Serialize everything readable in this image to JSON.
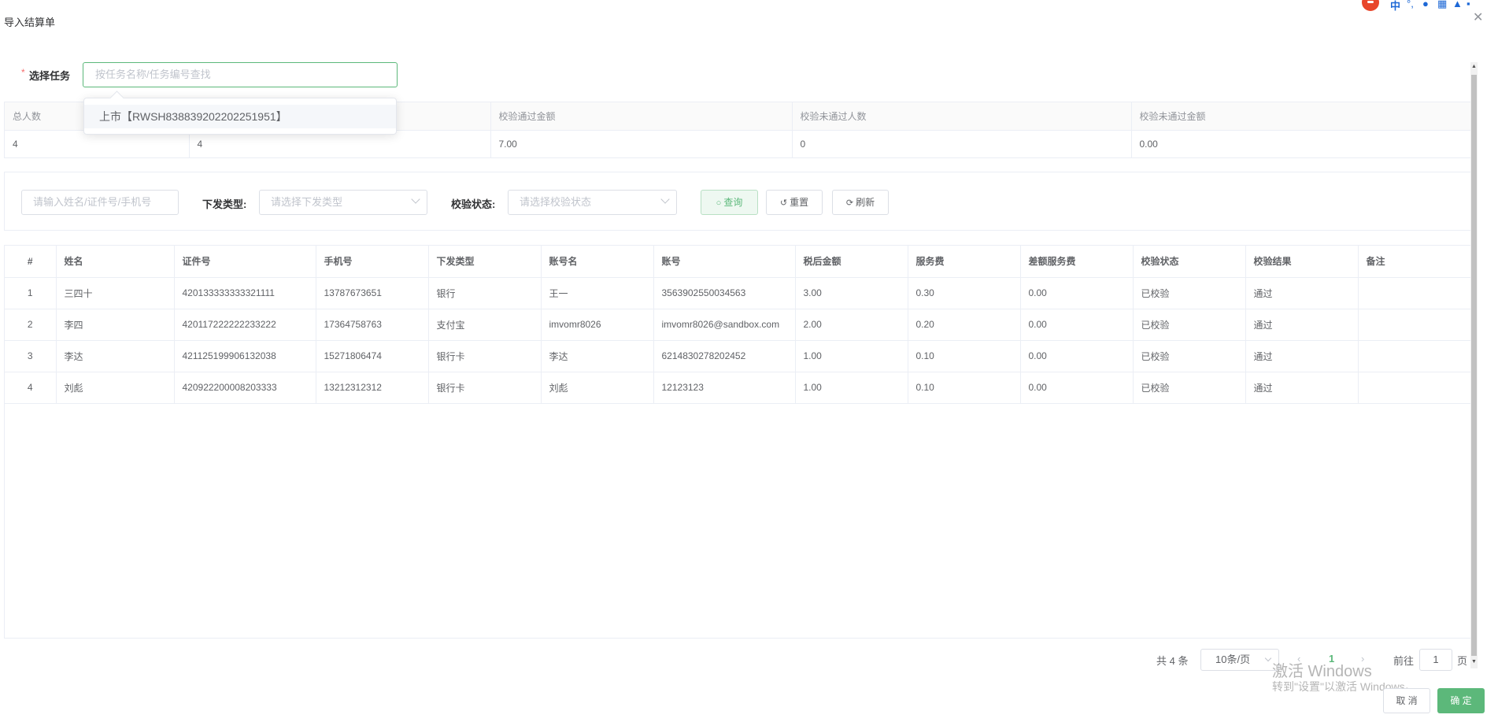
{
  "dialog": {
    "title": "导入结算单",
    "close_glyph": "✕"
  },
  "ime_toolbar": {
    "icons": [
      "sogou-logo-icon",
      "chinese-mode-icon",
      "punctuation-icon",
      "microphone-icon",
      "keyboard-icon",
      "skin-icon",
      "toolbox-icon"
    ],
    "mode_label": "中"
  },
  "form": {
    "label": "选择任务",
    "required_mark": "*",
    "task_placeholder": "按任务名称/任务编号查找",
    "dropdown_option": "上市【RWSH838839202202251951】"
  },
  "summary": {
    "headers": [
      "总人数",
      "",
      "校验通过金额",
      "校验未通过人数",
      "校验未通过金额"
    ],
    "values": [
      "4",
      "4",
      "7.00",
      "0",
      "0.00"
    ]
  },
  "filters": {
    "search_placeholder": "请输入姓名/证件号/手机号",
    "type_label": "下发类型:",
    "type_placeholder": "请选择下发类型",
    "status_label": "校验状态:",
    "status_placeholder": "请选择校验状态",
    "query_button": "查询",
    "reset_button": "重置",
    "refresh_button": "刷新"
  },
  "table": {
    "columns": [
      "#",
      "姓名",
      "证件号",
      "手机号",
      "下发类型",
      "账号名",
      "账号",
      "税后金额",
      "服务费",
      "差额服务费",
      "校验状态",
      "校验结果",
      "备注"
    ],
    "rows": [
      [
        "1",
        "三四十",
        "420133333333321111",
        "13787673651",
        "银行",
        "王一",
        "3563902550034563",
        "3.00",
        "0.30",
        "0.00",
        "已校验",
        "通过",
        ""
      ],
      [
        "2",
        "李四",
        "420117222222233222",
        "17364758763",
        "支付宝",
        "imvomr8026",
        "imvomr8026@sandbox.com",
        "2.00",
        "0.20",
        "0.00",
        "已校验",
        "通过",
        ""
      ],
      [
        "3",
        "李达",
        "421125199906132038",
        "15271806474",
        "银行卡",
        "李达",
        "6214830278202452",
        "1.00",
        "0.10",
        "0.00",
        "已校验",
        "通过",
        ""
      ],
      [
        "4",
        "刘彪",
        "420922200008203333",
        "13212312312",
        "银行卡",
        "刘彪",
        "12123123",
        "1.00",
        "0.10",
        "0.00",
        "已校验",
        "通过",
        ""
      ]
    ]
  },
  "pagination": {
    "total": "共 4 条",
    "page_size": "10条/页",
    "prev": "‹",
    "current_page": "1",
    "next": "›",
    "goto_label": "前往",
    "goto_value": "1",
    "page_suffix": "页"
  },
  "watermark": {
    "line1": "激活 Windows",
    "line2": "转到\"设置\"以激活 Windows。"
  },
  "footer": {
    "cancel": "取 消",
    "confirm": "确 定"
  },
  "colors": {
    "primary": "#5cb87a",
    "required": "#f56c6c",
    "border": "#ebeef5",
    "ime_brand": "#e8462b"
  }
}
